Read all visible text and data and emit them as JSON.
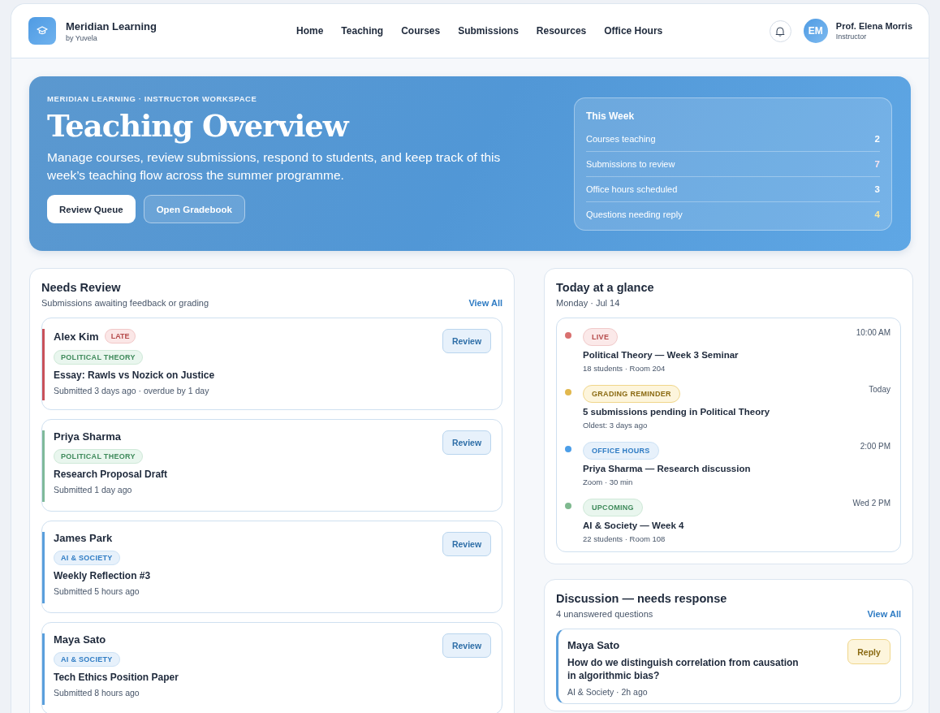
{
  "brand": {
    "name": "Meridian Learning",
    "sub": "by Yuvela"
  },
  "nav": [
    {
      "label": "Home",
      "selected": false
    },
    {
      "label": "Teaching",
      "selected": false
    },
    {
      "label": "Courses",
      "selected": false
    },
    {
      "label": "Submissions",
      "selected": false
    },
    {
      "label": "Resources",
      "selected": false
    },
    {
      "label": "Office Hours",
      "selected": false
    }
  ],
  "user": {
    "initials": "EM",
    "name": "Prof. Elena Morris",
    "role": "Instructor"
  },
  "hero": {
    "eyebrow": "MERIDIAN LEARNING · INSTRUCTOR WORKSPACE",
    "title": "Teaching Overview",
    "text": "Manage courses, review submissions, respond to students, and keep track of this week’s teaching flow across the summer programme.",
    "buttons": [
      {
        "label": "Review Queue",
        "kind": "primary"
      },
      {
        "label": "Open Gradebook",
        "kind": "ghost"
      }
    ],
    "week": {
      "title": "This Week",
      "stats": [
        {
          "label": "Courses teaching",
          "value": "2",
          "color": "#ffffff"
        },
        {
          "label": "Submissions to review",
          "value": "7",
          "color": "#fbe4ee"
        },
        {
          "label": "Office hours scheduled",
          "value": "3",
          "color": "#ffffff"
        },
        {
          "label": "Questions needing reply",
          "value": "4",
          "color": "#fdeaa0"
        }
      ]
    }
  },
  "review": {
    "title": "Needs Review",
    "subtitle": "Submissions awaiting feedback or grading",
    "link": "View All",
    "items": [
      {
        "name": "Alex Kim",
        "flag": "LATE",
        "color": "#c9515a",
        "tag": {
          "label": "POLITICAL THEORY",
          "kind": "green"
        },
        "title": "Essay: Rawls vs Nozick on Justice",
        "meta": "Submitted 3 days ago · overdue by 1 day",
        "action": "Review"
      },
      {
        "name": "Priya Sharma",
        "color": "#7fb99a",
        "tag": {
          "label": "POLITICAL THEORY",
          "kind": "green"
        },
        "title": "Research Proposal Draft",
        "meta": "Submitted 1 day ago",
        "action": "Review"
      },
      {
        "name": "James Park",
        "color": "#5a9fdc",
        "tag": {
          "label": "AI & SOCIETY",
          "kind": "blue"
        },
        "title": "Weekly Reflection #3",
        "meta": "Submitted 5 hours ago",
        "action": "Review"
      },
      {
        "name": "Maya Sato",
        "color": "#5a9fdc",
        "tag": {
          "label": "AI & SOCIETY",
          "kind": "blue"
        },
        "title": "Tech Ethics Position Paper",
        "meta": "Submitted 8 hours ago",
        "action": "Review"
      }
    ]
  },
  "today": {
    "title": "Today at a glance",
    "subtitle": "Monday · Jul 14",
    "events": [
      {
        "badge": "LIVE",
        "kind": "live",
        "color": "#d9706f",
        "time": "10:00 AM",
        "title": "Political Theory — Week 3 Seminar",
        "meta": "18 students · Room 204"
      },
      {
        "badge": "GRADING REMINDER",
        "kind": "reminder",
        "color": "#e2b84e",
        "time": "Today",
        "title": "5 submissions pending in Political Theory",
        "meta": "Oldest: 3 days ago"
      },
      {
        "badge": "OFFICE HOURS",
        "kind": "office",
        "color": "#4c9ee8",
        "time": "2:00 PM",
        "title": "Priya Sharma — Research discussion",
        "meta": "Zoom · 30 min"
      },
      {
        "badge": "UPCOMING",
        "kind": "upcoming",
        "color": "#7fb98f",
        "time": "Wed 2 PM",
        "title": "AI & Society — Week 4",
        "meta": "22 students · Room 108"
      }
    ]
  },
  "discussion": {
    "title": "Discussion — needs response",
    "subtitle": "4 unanswered questions",
    "link": "View All",
    "items": [
      {
        "name": "Maya Sato",
        "question": "How do we distinguish correlation from causation in algorithmic bias?",
        "meta": "AI & Society · 2h ago",
        "action": "Reply"
      }
    ]
  }
}
